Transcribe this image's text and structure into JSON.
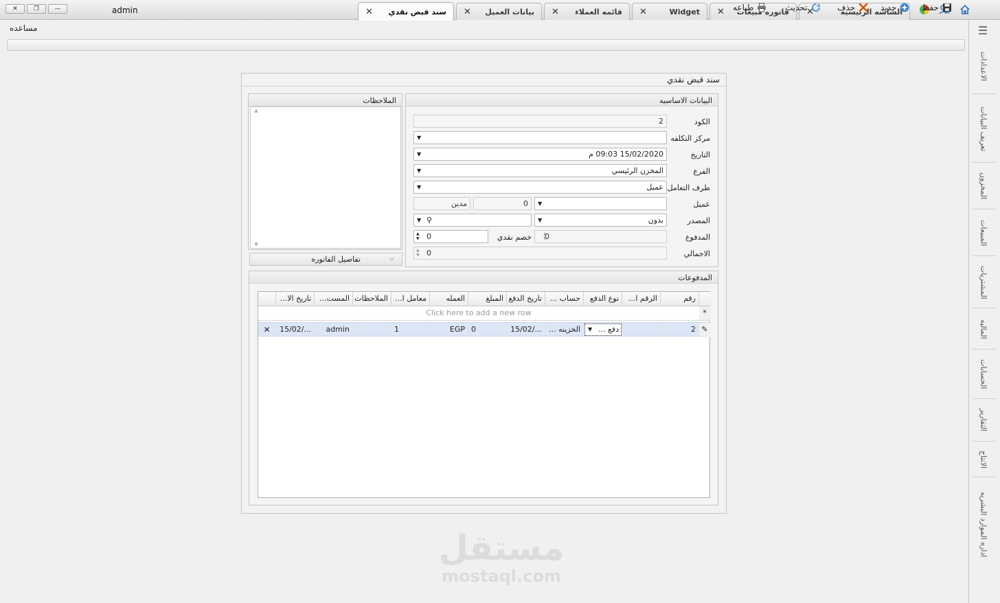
{
  "window": {
    "title": "admin"
  },
  "tabs": [
    {
      "label": "الشاشه الرئيسيه"
    },
    {
      "label": "فاتوره مبيعات"
    },
    {
      "label": "Widget"
    },
    {
      "label": "قائمه العملاء"
    },
    {
      "label": "بيانات العميل"
    },
    {
      "label": "سند قبض نقدي"
    }
  ],
  "toolbar": {
    "save_label": "حفظ",
    "new_label": "جديد",
    "delete_label": "حذف",
    "refresh_label": "تحديث",
    "print_label": "طباعه",
    "help_label": "مساعده"
  },
  "sidebar": {
    "items": [
      {
        "label": "الاعدادات"
      },
      {
        "label": "تعريف البيانات"
      },
      {
        "label": "المخزون"
      },
      {
        "label": "المبيعات"
      },
      {
        "label": "المشتريات"
      },
      {
        "label": "الماليه"
      },
      {
        "label": "الحسابات"
      },
      {
        "label": "التقارير"
      },
      {
        "label": "الانتاج"
      },
      {
        "label": "اداره الموارد البشريه"
      }
    ]
  },
  "form": {
    "title": "سند قبض نقدي",
    "basic_title": "البيانات الاساسيه",
    "notes_title": "الملاحظات",
    "invoice_details_label": "تفاصيل الفاتوره",
    "labels": {
      "code": "الكود",
      "cost_center": "مركز التكلفه",
      "date": "التاريخ",
      "branch": "الفرع",
      "party_type": "طرف التعامل",
      "customer": "عميل",
      "source": "المصدر",
      "paid": "المدفوع",
      "cash_discount": "خصم نقدي",
      "total": "الاجمالي"
    },
    "values": {
      "code": "2",
      "cost_center": "",
      "date": "15/02/2020 09:03 م",
      "branch": "المخزن الرئيسي",
      "party_type": "عميل",
      "customer": "",
      "balance": "0",
      "balance_type": "مدين",
      "source": "بدون",
      "source_ref": "",
      "paid": "0",
      "cash_discount": "0",
      "total": "0"
    }
  },
  "payments": {
    "title": "المدفوعات",
    "columns": [
      "رقم",
      "الرقم ا...",
      "نوع الدفع",
      "حساب ...",
      "تاريخ الدفع",
      "المبلغ",
      "العمله",
      "معامل ا...",
      "الملاحظات",
      "المست...",
      "تاريخ الا..."
    ],
    "new_row_text": "Click here to add a new row",
    "rows": [
      {
        "number": "2",
        "ref_number": "",
        "payment_type": "دفع ...",
        "account": "الخزينه ...",
        "payment_date": "15/02/...",
        "amount": "0",
        "currency": "EGP",
        "rate": "1",
        "notes": "",
        "user": "admin",
        "add_date": "15/02/..."
      }
    ]
  },
  "watermark": {
    "text_ar": "مستقل",
    "text_en": "mostaql.com"
  },
  "colors": {
    "accent": "#2c6fb6",
    "delete": "#c0392b"
  }
}
